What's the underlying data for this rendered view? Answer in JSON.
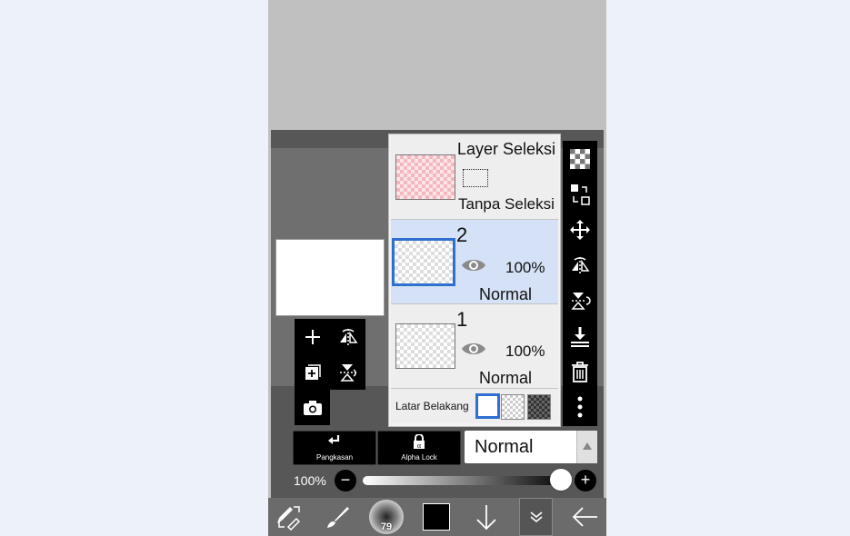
{
  "selection_layer": {
    "title": "Layer Seleksi",
    "status": "Tanpa Seleksi"
  },
  "layers": [
    {
      "number": "2",
      "opacity": "100%",
      "blend": "Normal",
      "selected": true
    },
    {
      "number": "1",
      "opacity": "100%",
      "blend": "Normal",
      "selected": false
    }
  ],
  "background": {
    "label": "Latar Belakang"
  },
  "buttons": {
    "clipping": "Pangkasan",
    "alpha_lock": "Alpha Lock"
  },
  "blend_mode": {
    "value": "Normal"
  },
  "opacity": {
    "label": "100%",
    "value": 1.0
  },
  "brush": {
    "size": "79"
  },
  "colors": {
    "accent": "#2f6fd0",
    "primary_color": "#000000"
  },
  "icons": [
    "add-layer-icon",
    "flip-horizontal-icon",
    "add-copy-icon",
    "flip-vertical-icon",
    "camera-icon",
    "checkerboard-icon",
    "transform-icon",
    "move-icon",
    "flip-icon",
    "rotate-icon",
    "merge-down-icon",
    "trash-icon",
    "more-icon",
    "eye-icon",
    "swap-tools-icon",
    "brush-icon",
    "arrow-down-icon",
    "chevron-down-icon",
    "back-arrow-icon"
  ]
}
